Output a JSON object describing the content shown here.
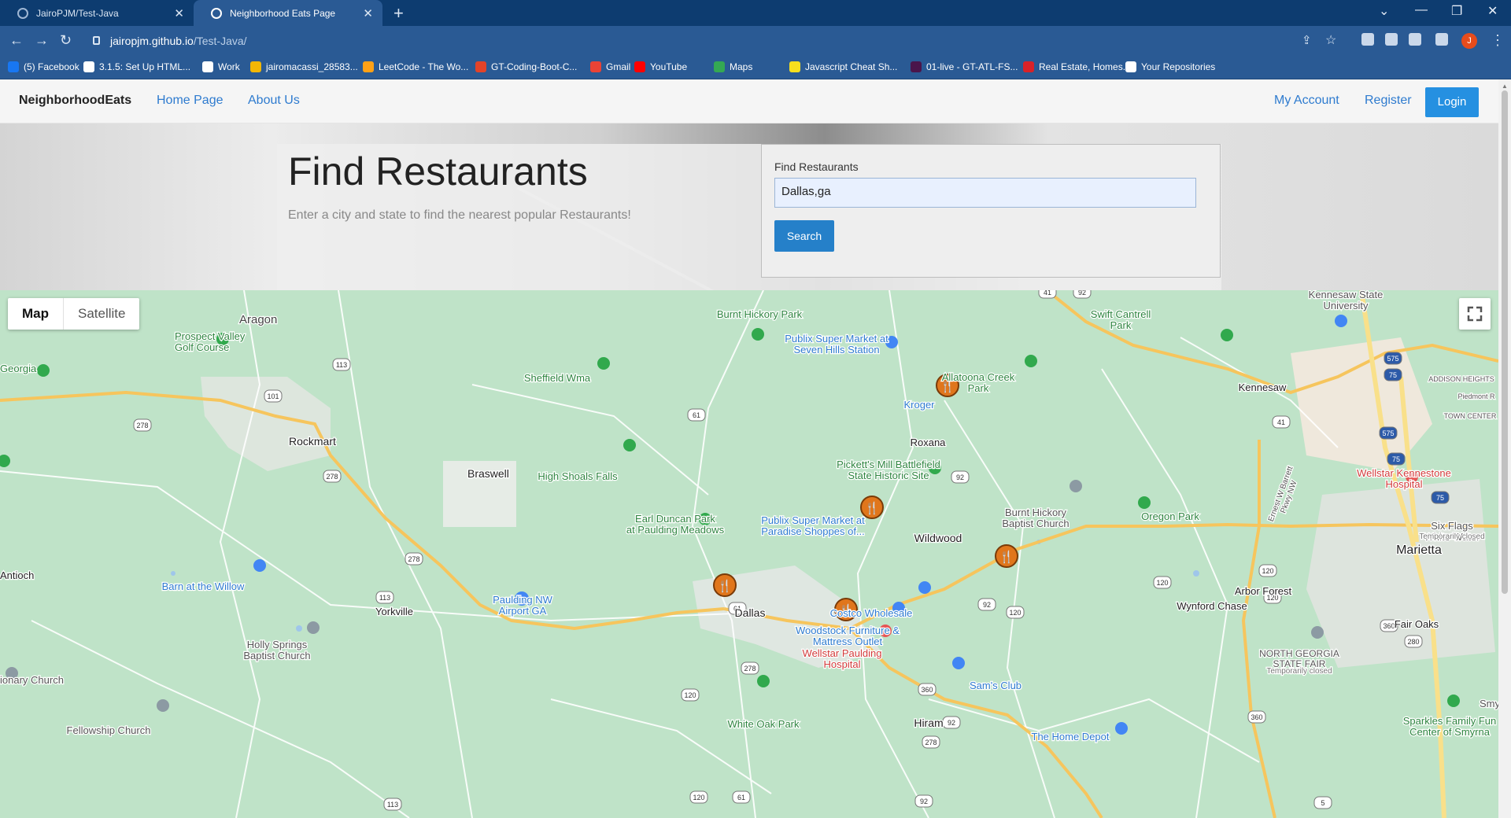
{
  "browser": {
    "tabs": [
      {
        "title": "JairoPJM/Test-Java"
      },
      {
        "title": "Neighborhood Eats Page"
      }
    ],
    "url_host": "jairopjm.github.io",
    "url_path": "/Test-Java/",
    "avatar_letter": "J",
    "bookmarks": [
      {
        "label": "(5) Facebook",
        "color": "#1877f2"
      },
      {
        "label": "3.1.5: Set Up HTML...",
        "color": "#ffffff"
      },
      {
        "label": "Work",
        "color": "#ffffff"
      },
      {
        "label": "jairomacassi_28583...",
        "color": "#f2b705"
      },
      {
        "label": "LeetCode - The Wo...",
        "color": "#ffa116"
      },
      {
        "label": "GT-Coding-Boot-C...",
        "color": "#e24329"
      },
      {
        "label": "Gmail",
        "color": "#ea4335"
      },
      {
        "label": "YouTube",
        "color": "#ff0000"
      },
      {
        "label": "Maps",
        "color": "#34a853"
      },
      {
        "label": "Javascript Cheat Sh...",
        "color": "#f7df1e"
      },
      {
        "label": "01-live - GT-ATL-FS...",
        "color": "#4a154b"
      },
      {
        "label": "Real Estate, Homes...",
        "color": "#d92228"
      },
      {
        "label": "Your Repositories",
        "color": "#ffffff"
      }
    ]
  },
  "nav": {
    "brand": "NeighborhoodEats",
    "links": [
      "Home Page",
      "About Us"
    ],
    "right_links": [
      "My Account",
      "Register"
    ],
    "login": "Login"
  },
  "hero": {
    "title": "Find Restaurants",
    "subtitle": "Enter a city and state to find the nearest popular Restaurants!",
    "form_label": "Find Restaurants",
    "search_value": "Dallas,ga",
    "search_button": "Search"
  },
  "map": {
    "type_buttons": [
      "Map",
      "Satellite"
    ],
    "places": [
      "Aragon",
      "Prospect Valley Golf Course",
      "Georgia",
      "Rockmart",
      "Braswell",
      "Antioch",
      "Sheffield Wma",
      "High Shoals Falls",
      "Burnt Hickory Park",
      "Publix Super Market at Seven Hills Station",
      "Allatoona Creek Park",
      "Kroger",
      "Roxana",
      "Pickett's Mill Battlefield State Historic Site",
      "Earl Duncan Park at Paulding Meadows",
      "Publix Super Market at Paradise Shoppes of...",
      "Wildwood",
      "Burnt Hickory Baptist Church",
      "Oregon Park",
      "Swift Cantrell Park",
      "Kennesaw State University",
      "Kennesaw",
      "ADDISON HEIGHTS",
      "TOWN CENTER",
      "Piedmont R",
      "Wellstar Kennestone Hospital",
      "Six Flags White Water",
      "Temporarily closed",
      "Marietta",
      "Arbor Forest",
      "Wynford Chase",
      "Fair Oaks",
      "NORTH GEORGIA STATE FAIR",
      "Temporarily closed",
      "Barn at the Willow",
      "Yorkville",
      "Paulding NW Airport GA",
      "Holly Springs Baptist Church",
      "Dallas",
      "Costco Wholesale",
      "Woodstock Furniture & Mattress Outlet",
      "Wellstar Paulding Hospital",
      "Sam's Club",
      "Hiram",
      "White Oak Park",
      "Fellowship Church",
      "The Home Depot",
      "Sparkles Family Fun Center of Smyrna",
      "Smy",
      "ionary Church",
      "Ernest W Barrett Pkwy NW"
    ],
    "route_shields": [
      "41",
      "92",
      "101",
      "113",
      "278",
      "278",
      "278",
      "61",
      "92",
      "113",
      "61",
      "120",
      "278",
      "360",
      "92",
      "278",
      "120",
      "61",
      "120",
      "92",
      "41",
      "575",
      "75",
      "575",
      "75",
      "75",
      "120",
      "360",
      "280",
      "360",
      "120",
      "5",
      "113",
      "120",
      "92"
    ]
  }
}
